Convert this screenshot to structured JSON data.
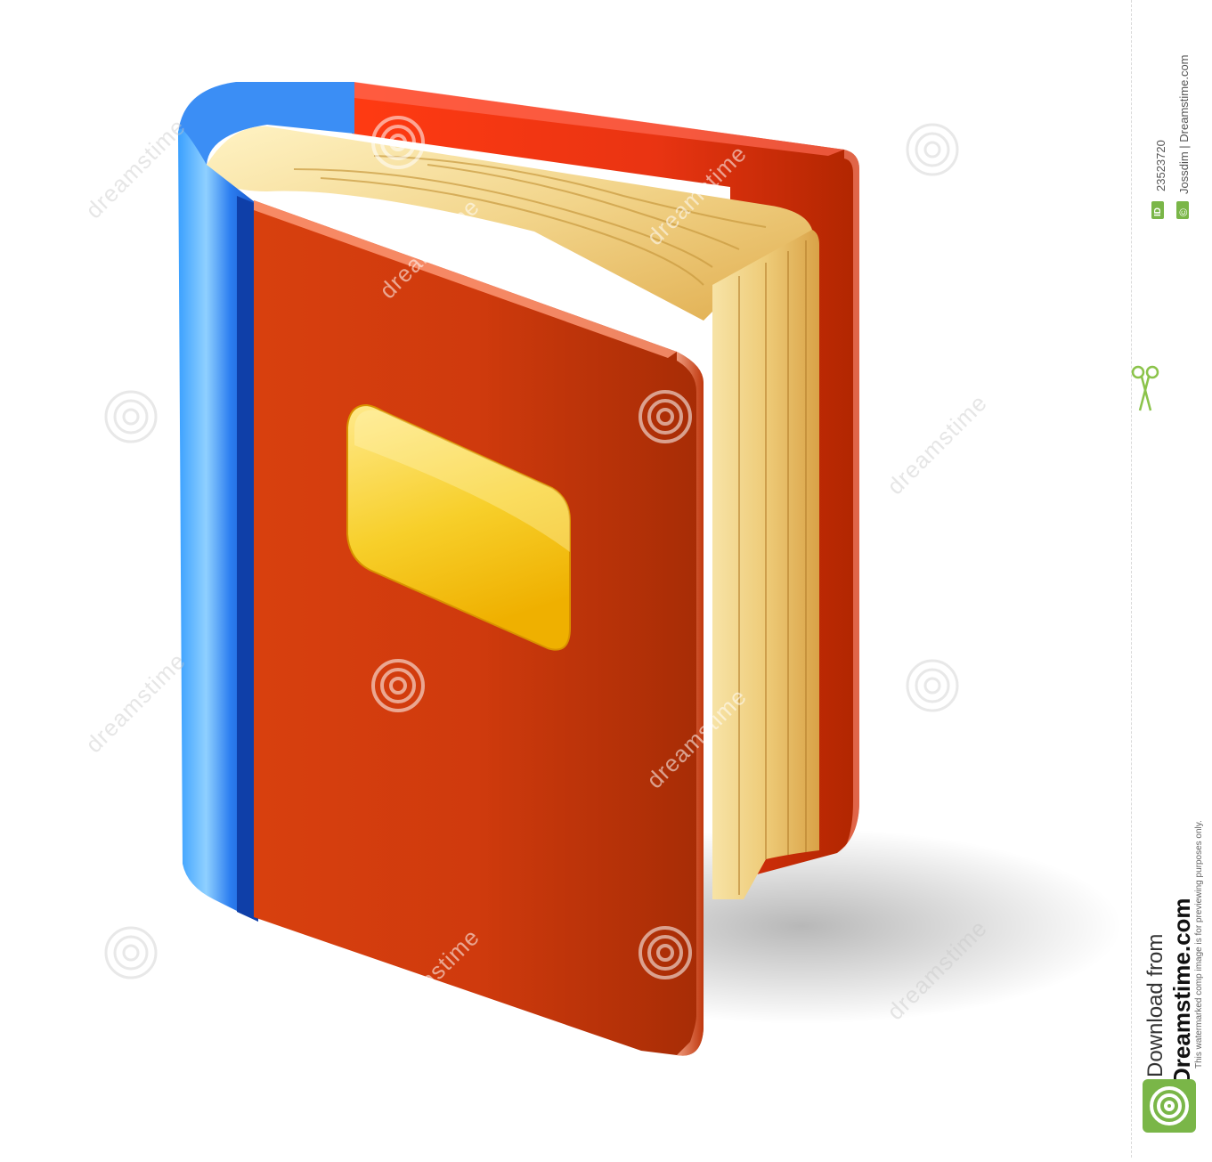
{
  "image": {
    "subject": "",
    "watermark_text": "dreamstime"
  },
  "sidebar": {
    "id_label": "ID",
    "id_value": "23523720",
    "copyright_symbol": "©",
    "credit": "Jossdim | Dreamstime.com",
    "download_label": "Download from",
    "download_site": "Dreamstime.com",
    "note": "This watermarked comp image is for previewing purposes only.",
    "scissors_icon": "scissors-icon",
    "logo_icon": "dreamstime-spiral-logo"
  },
  "colors": {
    "cover_red": "#d63a10",
    "cover_red_dark": "#a02800",
    "spine_blue": "#1f6fe0",
    "page_gold": "#f3d27a",
    "label_gold": "#f4c21a",
    "badge_green": "#7ab648"
  }
}
